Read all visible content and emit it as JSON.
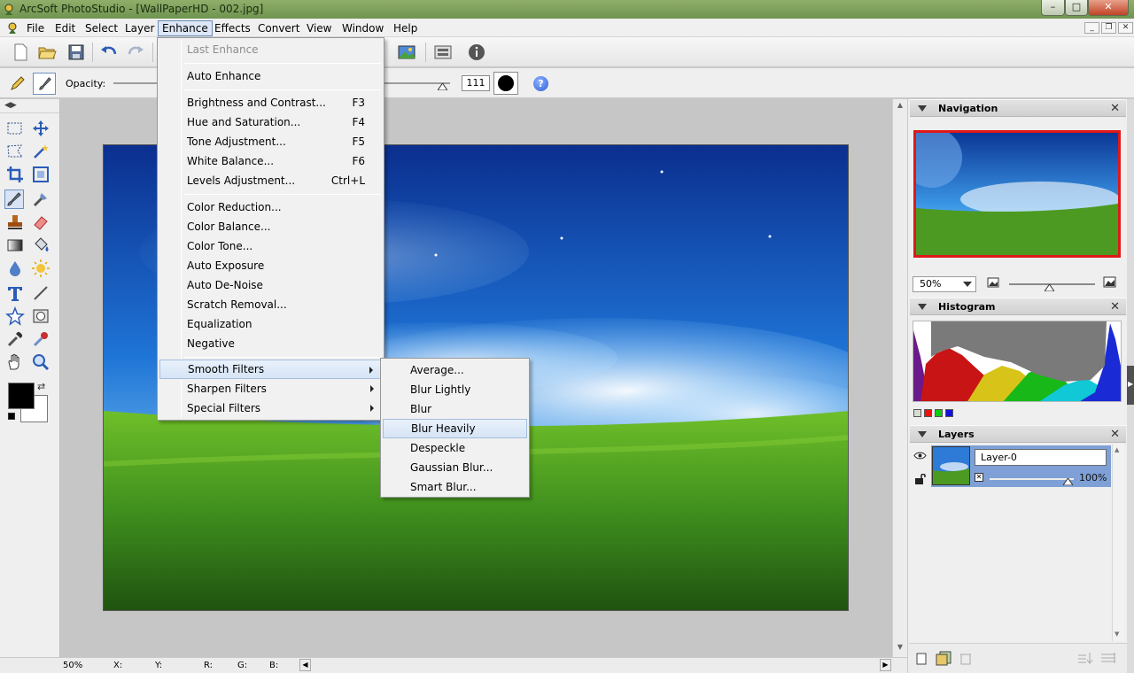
{
  "window": {
    "title": "ArcSoft PhotoStudio - [WallPaperHD - 002.jpg]",
    "min": "–",
    "max": "□",
    "close": "✕"
  },
  "menubar": [
    "File",
    "Edit",
    "Select",
    "Layer",
    "Enhance",
    "Effects",
    "Convert",
    "View",
    "Window",
    "Help"
  ],
  "options": {
    "opacity_label": "Opacity:",
    "size_value": "111",
    "help": "?"
  },
  "enhance_menu": {
    "last_enhance": "Last Enhance",
    "auto_enhance": "Auto Enhance",
    "group1": [
      {
        "label": "Brightness and Contrast...",
        "shortcut": "F3"
      },
      {
        "label": "Hue and Saturation...",
        "shortcut": "F4"
      },
      {
        "label": "Tone Adjustment...",
        "shortcut": "F5"
      },
      {
        "label": "White Balance...",
        "shortcut": "F6"
      },
      {
        "label": "Levels Adjustment...",
        "shortcut": "Ctrl+L"
      }
    ],
    "group2": [
      "Color Reduction...",
      "Color Balance...",
      "Color Tone...",
      "Auto Exposure",
      "Auto De-Noise",
      "Scratch Removal...",
      "Equalization",
      "Negative"
    ],
    "group3": [
      "Smooth Filters",
      "Sharpen Filters",
      "Special Filters"
    ]
  },
  "smooth_submenu": [
    "Average...",
    "Blur Lightly",
    "Blur",
    "Blur Heavily",
    "Despeckle",
    "Gaussian Blur...",
    "Smart Blur..."
  ],
  "statusbar": {
    "zoom": "50%",
    "x": "X:",
    "y": "Y:",
    "r": "R:",
    "g": "G:",
    "b": "B:"
  },
  "panels": {
    "navigation": "Navigation",
    "zoom": "50%",
    "histogram": "Histogram",
    "layers": "Layers",
    "layer_name": "Layer-0",
    "layer_opacity": "100%",
    "close": "✕"
  },
  "colors": {
    "accent": "#7ea0d6",
    "nav_border": "#e01818",
    "titlebar": "#7fa05c"
  }
}
